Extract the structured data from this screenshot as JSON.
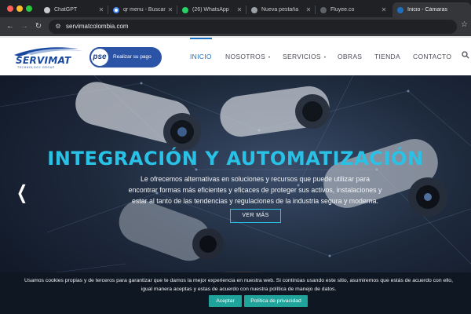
{
  "browser": {
    "tabs": [
      {
        "title": "ChatGPT",
        "active": false,
        "icon": "chatgpt-icon",
        "icon_color": "#c8cacd"
      },
      {
        "title": "qr menu - Buscar",
        "active": false,
        "icon": "google-icon",
        "icon_color": "#4285f4"
      },
      {
        "title": "(26) WhatsApp",
        "active": false,
        "icon": "whatsapp-icon",
        "icon_color": "#25d366"
      },
      {
        "title": "Nueva pestaña",
        "active": false,
        "icon": "chrome-icon",
        "icon_color": "#9aa0a6"
      },
      {
        "title": "Fluyee.co",
        "active": false,
        "icon": "globe-icon",
        "icon_color": "#9aa0a6"
      },
      {
        "title": "Inicio - Cámaras",
        "active": true,
        "icon": "site-icon",
        "icon_color": "#1f6fbf"
      }
    ],
    "address": "servimatcolombia.com"
  },
  "site": {
    "logo_text": "SERVIMAT",
    "logo_subtext": "TECHNOLOGY GROUP",
    "pse_text": "pse",
    "pse_label": "Realizar su pago",
    "menu": [
      {
        "label": "INICIO",
        "active": true,
        "dropdown": false
      },
      {
        "label": "NOSOTROS",
        "active": false,
        "dropdown": true
      },
      {
        "label": "SERVICIOS",
        "active": false,
        "dropdown": true
      },
      {
        "label": "OBRAS",
        "active": false,
        "dropdown": false
      },
      {
        "label": "TIENDA",
        "active": false,
        "dropdown": false
      },
      {
        "label": "CONTACTO",
        "active": false,
        "dropdown": false
      }
    ],
    "accent_color": "#1f6fbf"
  },
  "hero": {
    "headline": "INTEGRACIÓN Y AUTOMATIZACIÓN",
    "text_lines": [
      "Le ofrecemos alternativas en soluciones y recursos que puede utilizar para",
      "encontrar formas más eficientes y eficaces de proteger sus activos, instalaciones y",
      "estar al tanto de las tendencias y regulaciones de la industria segura y moderna."
    ],
    "cta": "VER MÁS",
    "headline_color": "#29c2e6"
  },
  "cookie": {
    "text_line1": "Usamos cookies propias y de terceros para garantizar que te damos la mejor experiencia en nuestra web. Si continúas usando este sitio, asumiremos que estás de acuerdo con ello,",
    "text_line2": "igual manera aceptas y estas de acuerdo con nuestra política de manejo de datos.",
    "accept": "Aceptar",
    "privacy": "Política de privacidad",
    "button_color": "#1fa39b"
  }
}
